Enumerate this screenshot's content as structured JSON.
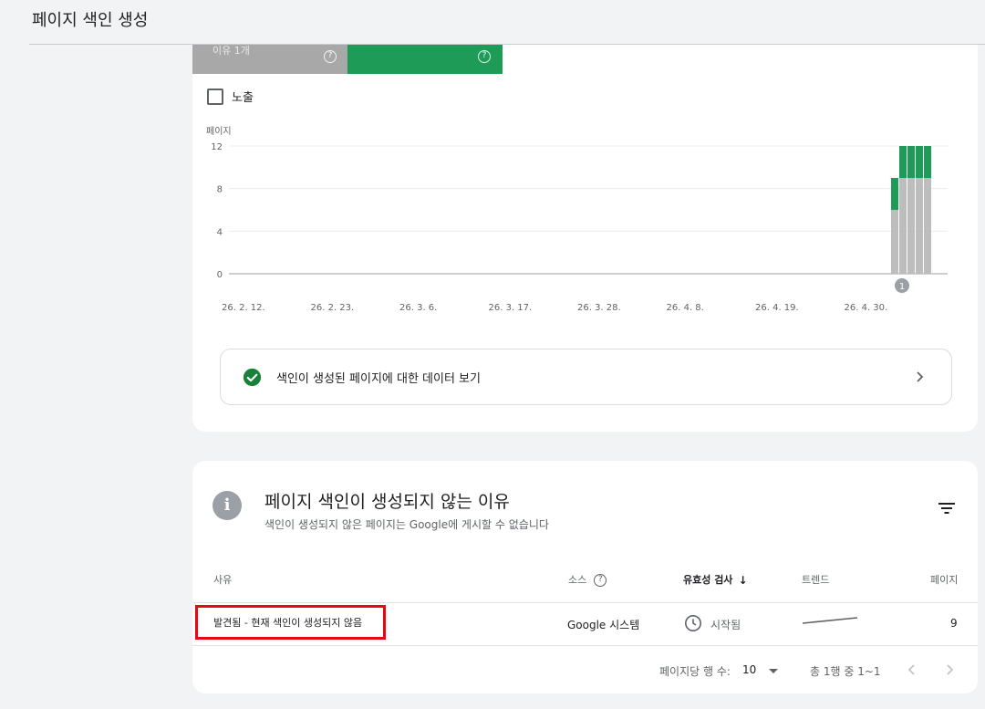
{
  "page": {
    "title": "페이지 색인 생성"
  },
  "tiles": [
    {
      "label": "이유 1개",
      "color": "#a8a8a8"
    },
    {
      "label": "",
      "color": "#1e9c57"
    }
  ],
  "impressions": {
    "label": "노출",
    "checked": false
  },
  "chart_data": {
    "type": "bar",
    "stacked": true,
    "ylabel": "페이지",
    "ylim": [
      0,
      12
    ],
    "yticks": [
      "12",
      "8",
      "4",
      "0"
    ],
    "xticks": [
      "26. 2. 12.",
      "26. 2. 23.",
      "26. 3. 6.",
      "26. 3. 17.",
      "26. 3. 28.",
      "26. 4. 8.",
      "26. 4. 19.",
      "26. 4. 30."
    ],
    "series": [
      {
        "color": "#bdbdbd",
        "values": [
          6,
          9,
          9,
          9,
          9
        ]
      },
      {
        "color": "#1e9c57",
        "values": [
          3,
          3,
          3,
          3,
          3
        ]
      }
    ],
    "annotation": "1",
    "grid": true
  },
  "view_data": {
    "label": "색인이 생성된 페이지에 대한 데이터 보기"
  },
  "reasons": {
    "title": "페이지 색인이 생성되지 않는 이유",
    "subtitle": "색인이 생성되지 않은 페이지는 Google에 게시할 수 없습니다",
    "columns": {
      "reason": "사유",
      "source": "소스",
      "validation": "유효성 검사",
      "trend": "트렌드",
      "pages": "페이지"
    },
    "rows": [
      {
        "reason": "발견됨 - 현재 색인이 생성되지 않음",
        "source": "Google 시스템",
        "validation": "시작됨",
        "pages": "9"
      }
    ],
    "pager": {
      "rows_label": "페이지당 행 수:",
      "rows_value": "10",
      "range": "총 1행 중 1~1"
    }
  }
}
